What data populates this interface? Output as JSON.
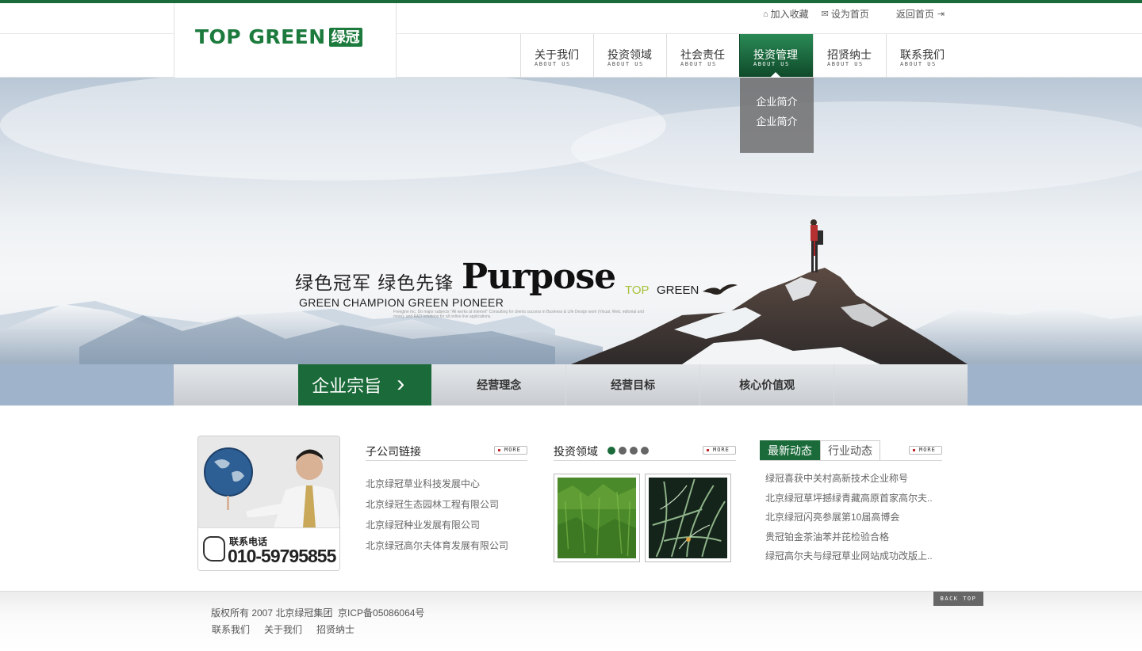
{
  "brand": {
    "logo_text": "TOP GREEN",
    "logo_badge": "绿冠",
    "accent_color": "#1b6b3a"
  },
  "toplinks": {
    "favorite": "加入收藏",
    "favorite_icon": "home-icon",
    "homepage": "设为首页",
    "homepage_icon": "mail-icon",
    "back": "返回首页",
    "back_icon": "exit-icon"
  },
  "nav": {
    "items": [
      {
        "cn": "关于我们",
        "en": "ABOUT US"
      },
      {
        "cn": "投资领域",
        "en": "ABOUT US"
      },
      {
        "cn": "社会责任",
        "en": "ABOUT US"
      },
      {
        "cn": "投资管理",
        "en": "ABOUT US",
        "active": true
      },
      {
        "cn": "招贤纳士",
        "en": "ABOUT US"
      },
      {
        "cn": "联系我们",
        "en": "ABOUT US"
      }
    ],
    "dropdown": [
      "企业简介",
      "企业简介"
    ]
  },
  "banner": {
    "slogan_cn": "绿色冠军  绿色先锋",
    "slogan_en": "GREEN CHAMPION GREEN PIONEER",
    "purpose": "Purpose",
    "top": "TOP",
    "green": "GREEN",
    "small_text": "Freegine Inc. Do major subjects \"All works at internet\" Consulting for clients success in Business & Life Design work (Visual, Web, editorial and more), and R&D solutions for all online live applications."
  },
  "tabs": {
    "active": "企业宗旨",
    "items": [
      "经营理念",
      "经营目标",
      "核心价值观"
    ]
  },
  "contact": {
    "label": "联系电话",
    "phone": "010-59795855"
  },
  "subsidiaries": {
    "title": "子公司链接",
    "more": "MORE",
    "items": [
      "北京绿冠草业科技发展中心",
      "北京绿冠生态园林工程有限公司",
      "北京绿冠种业发展有限公司",
      "北京绿冠高尔夫体育发展有限公司"
    ]
  },
  "investment": {
    "title": "投资领域",
    "more": "MORE",
    "dots": 4,
    "active_dot": 0
  },
  "news": {
    "tab_latest": "最新动态",
    "tab_industry": "行业动态",
    "more": "MORE",
    "items": [
      "绿冠喜获中关村高新技术企业称号",
      "北京绿冠草坪撼绿青藏高原首家高尔夫..",
      "北京绿冠闪亮参展第10届高博会",
      "贵冠铂金茶油苯并芘检验合格",
      "绿冠高尔夫与绿冠草业网站成功改版上.."
    ]
  },
  "footer": {
    "copyright": "版权所有 2007 北京绿冠集团  京ICP备05086064号",
    "links": [
      "联系我们",
      "关于我们",
      "招贤纳士"
    ],
    "backtop": "BACK TOP"
  }
}
